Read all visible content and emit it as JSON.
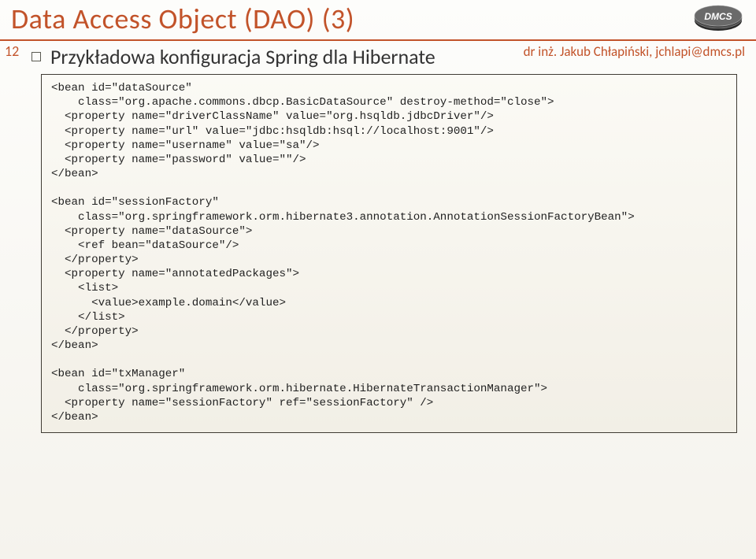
{
  "title": "Data Access Object (DAO) (3)",
  "page_number": "12",
  "author_line": "dr inż. Jakub Chłapiński, jchlapi@dmcs.pl",
  "logo_text": "DMCS",
  "bullet": "Przykładowa konfiguracja Spring dla Hibernate",
  "code": "<bean id=\"dataSource\"\n    class=\"org.apache.commons.dbcp.BasicDataSource\" destroy-method=\"close\">\n  <property name=\"driverClassName\" value=\"org.hsqldb.jdbcDriver\"/>\n  <property name=\"url\" value=\"jdbc:hsqldb:hsql://localhost:9001\"/>\n  <property name=\"username\" value=\"sa\"/>\n  <property name=\"password\" value=\"\"/>\n</bean>\n\n<bean id=\"sessionFactory\"\n    class=\"org.springframework.orm.hibernate3.annotation.AnnotationSessionFactoryBean\">\n  <property name=\"dataSource\">\n    <ref bean=\"dataSource\"/>\n  </property>\n  <property name=\"annotatedPackages\">\n    <list>\n      <value>example.domain</value>\n    </list>\n  </property>\n</bean>\n\n<bean id=\"txManager\"\n    class=\"org.springframework.orm.hibernate.HibernateTransactionManager\">\n  <property name=\"sessionFactory\" ref=\"sessionFactory\" />\n</bean>"
}
